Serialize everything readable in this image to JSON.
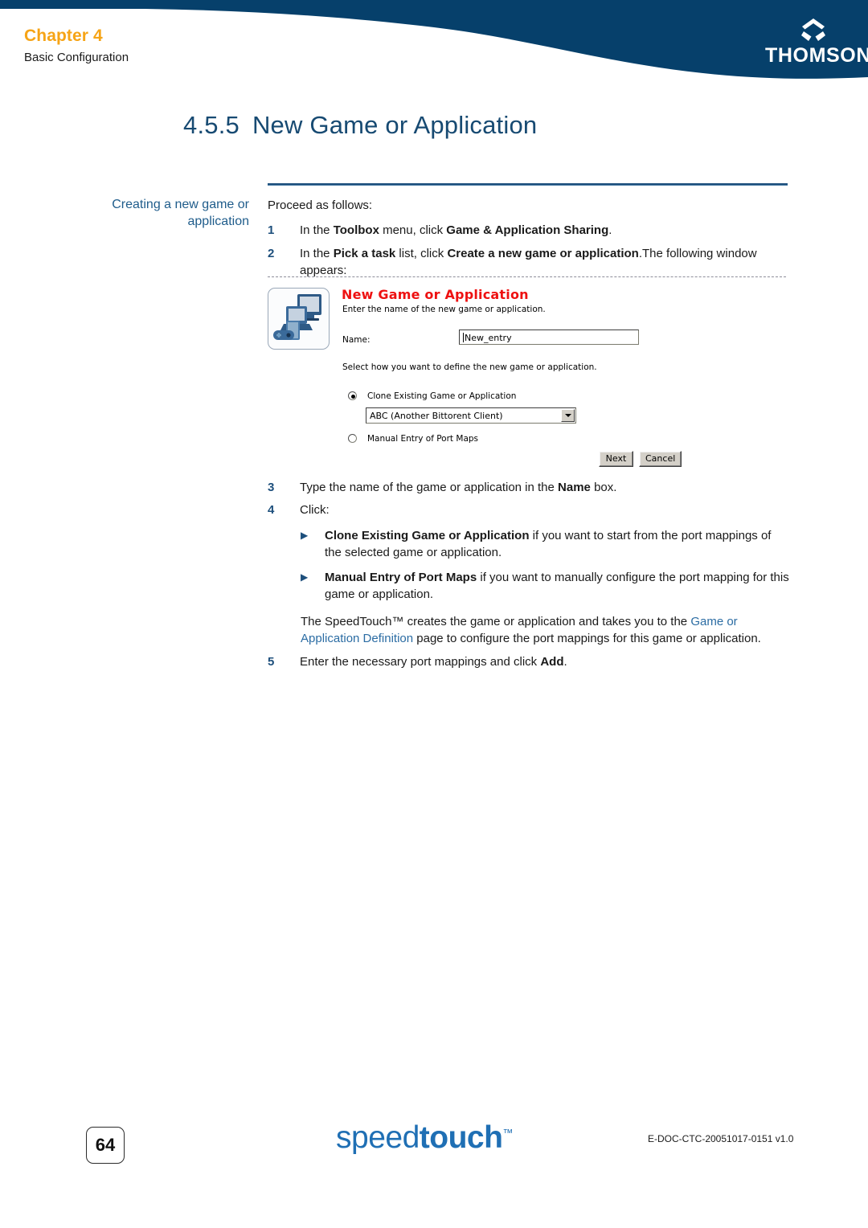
{
  "header": {
    "chapter": "Chapter 4",
    "chapter_subtitle": "Basic Configuration",
    "brand": "THOMSON",
    "banner_color": "#06406b",
    "chapter_color": "#f6a416"
  },
  "section": {
    "number": "4.5.5",
    "title": "New Game or Application"
  },
  "margin_heading": "Creating a new game or application",
  "body": {
    "lead": "Proceed as follows:",
    "steps": [
      {
        "num": "1",
        "parts": [
          {
            "t": "In the ",
            "b": false
          },
          {
            "t": "Toolbox",
            "b": true
          },
          {
            "t": " menu, click ",
            "b": false
          },
          {
            "t": "Game & Application Sharing",
            "b": true
          },
          {
            "t": ".",
            "b": false
          }
        ]
      },
      {
        "num": "2",
        "parts": [
          {
            "t": "In the ",
            "b": false
          },
          {
            "t": "Pick a task",
            "b": true
          },
          {
            "t": " list, click ",
            "b": false
          },
          {
            "t": "Create a new game or application",
            "b": true
          },
          {
            "t": ".The following window appears:",
            "b": false
          }
        ]
      }
    ],
    "steps2": [
      {
        "num": "3",
        "parts": [
          {
            "t": "Type the name of the game or application in the ",
            "b": false
          },
          {
            "t": "Name",
            "b": true
          },
          {
            "t": " box.",
            "b": false
          }
        ]
      },
      {
        "num": "4",
        "parts": [
          {
            "t": "Click:",
            "b": false
          }
        ]
      }
    ],
    "bullets": [
      {
        "marker": "▶",
        "parts": [
          {
            "t": "Clone Existing Game or Application",
            "b": true
          },
          {
            "t": " if you want to start from the port mappings of the selected game or application.",
            "b": false
          }
        ]
      },
      {
        "marker": "▶",
        "parts": [
          {
            "t": "Manual Entry of Port Maps",
            "b": true
          },
          {
            "t": " if you want to manually configure the port mapping for this game or application.",
            "b": false
          }
        ]
      }
    ],
    "paragraph": [
      {
        "t": "The SpeedTouch™ creates the game or application and takes you to the ",
        "b": false,
        "link": false
      },
      {
        "t": "Game or Application Definition",
        "b": false,
        "link": true
      },
      {
        "t": " page to configure the port mappings for this game or application.",
        "b": false,
        "link": false
      }
    ],
    "step5": {
      "num": "5",
      "parts": [
        {
          "t": "Enter the necessary port mappings and click ",
          "b": false
        },
        {
          "t": "Add",
          "b": true
        },
        {
          "t": ".",
          "b": false
        }
      ]
    }
  },
  "dialog": {
    "icon_name": "game-application-icon",
    "heading": "New Game or Application",
    "heading_color": "#ee1111",
    "subtitle": "Enter the name of the new game or application.",
    "name_label": "Name:",
    "name_value": "New_entry",
    "select_instruction": "Select how you want to define the new game or application.",
    "radio_clone_label": "Clone Existing Game or Application",
    "radio_clone_selected": true,
    "combo_value": "ABC (Another Bittorent Client)",
    "radio_manual_label": "Manual Entry of Port Maps",
    "radio_manual_selected": false,
    "next_label": "Next",
    "cancel_label": "Cancel"
  },
  "footer": {
    "page_number": "64",
    "logo_light": "speed",
    "logo_bold": "touch",
    "logo_tm": "™",
    "logo_color": "#1f6fb4",
    "doc_id": "E-DOC-CTC-20051017-0151 v1.0"
  }
}
